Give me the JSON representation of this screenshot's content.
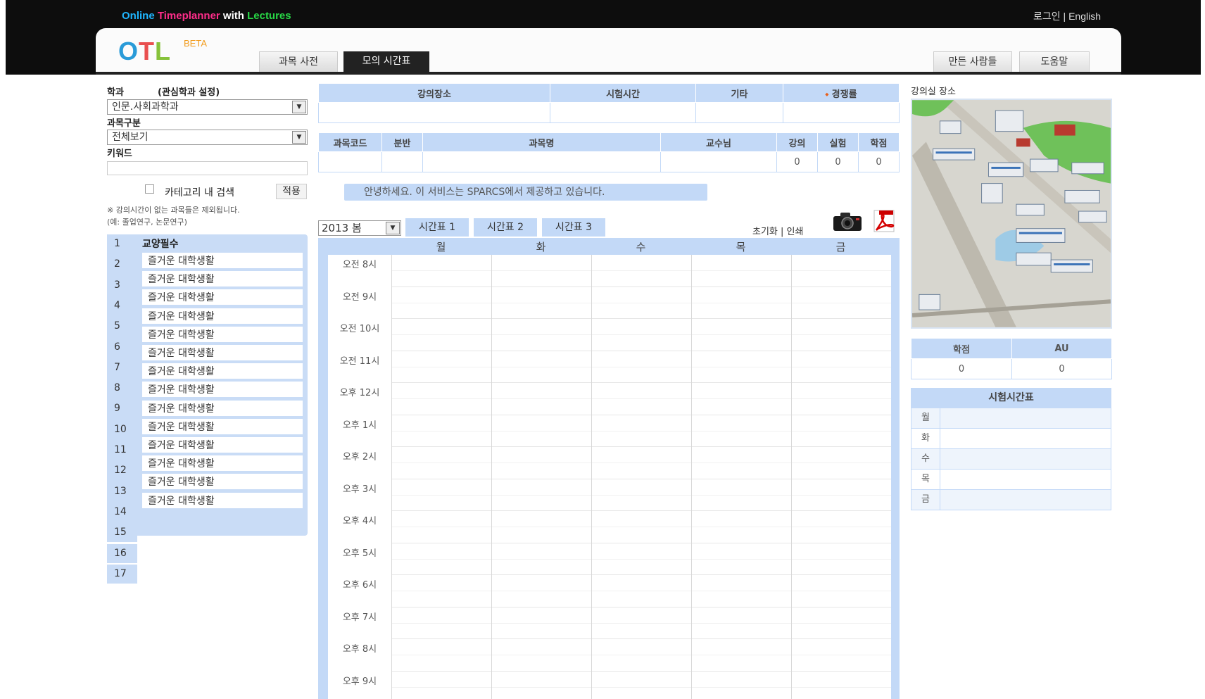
{
  "header": {
    "brand": [
      "Online ",
      "Timeplanner",
      " with ",
      "Lectures"
    ],
    "login": "로그인",
    "sep": " | ",
    "lang": "English",
    "logo": [
      "O",
      "T",
      "L"
    ],
    "beta": "BETA",
    "tabs": [
      "과목 사전",
      "모의 시간표"
    ],
    "right_tabs": [
      "만든 사람들",
      "도움말"
    ]
  },
  "filters": {
    "dept_label": "학과",
    "dept_fav": "(관심학과 설정)",
    "dept_value": "인문.사회과학과",
    "type_label": "과목구분",
    "type_value": "전체보기",
    "keyword_label": "키워드",
    "in_category": "카테고리 내 검색",
    "apply": "적용",
    "note1": "※ 강의시간이 없는 과목들은 제외됩니다.",
    "note2": "(예: 졸업연구, 논문연구)"
  },
  "category": {
    "numbers": [
      "1",
      "2",
      "3",
      "4",
      "5",
      "6",
      "7",
      "8",
      "9",
      "10",
      "11",
      "12",
      "13",
      "14",
      "15",
      "16",
      "17"
    ],
    "title": "교양필수",
    "courses": [
      "즐거운 대학생활",
      "즐거운 대학생활",
      "즐거운 대학생활",
      "즐거운 대학생활",
      "즐거운 대학생활",
      "즐거운 대학생활",
      "즐거운 대학생활",
      "즐거운 대학생활",
      "즐거운 대학생활",
      "즐거운 대학생활",
      "즐거운 대학생활",
      "즐거운 대학생활",
      "즐거운 대학생활",
      "즐거운 대학생활"
    ]
  },
  "info": {
    "headers": [
      "강의장소",
      "시험시간",
      "기타",
      "경쟁률"
    ],
    "course_headers": [
      "과목코드",
      "분반",
      "과목명",
      "교수님",
      "강의",
      "실험",
      "학점"
    ],
    "course_values": [
      "0",
      "0",
      "0"
    ],
    "banner": "안녕하세요. 이 서비스는 SPARCS에서 제공하고 있습니다."
  },
  "timetable": {
    "semester": "2013 봄",
    "tabs": [
      "시간표 1",
      "시간표 2",
      "시간표 3"
    ],
    "reset": "초기화",
    "sep": " | ",
    "print": "인쇄",
    "days": [
      "월",
      "화",
      "수",
      "목",
      "금"
    ],
    "times": [
      "오전 8시",
      "오전 9시",
      "오전 10시",
      "오전 11시",
      "오후 12시",
      "오후 1시",
      "오후 2시",
      "오후 3시",
      "오후 4시",
      "오후 5시",
      "오후 6시",
      "오후 7시",
      "오후 8시",
      "오후 9시"
    ]
  },
  "right": {
    "map_label": "강의실 장소",
    "credit_headers": [
      "학점",
      "AU"
    ],
    "credit_values": [
      "0",
      "0"
    ],
    "exam_title": "시험시간표",
    "exam_days": [
      "월",
      "화",
      "수",
      "목",
      "금"
    ]
  }
}
